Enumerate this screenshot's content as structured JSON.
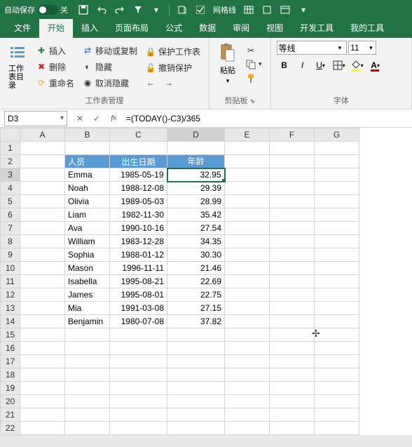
{
  "titlebar": {
    "autosave_label": "自动保存",
    "autosave_state": "关",
    "gridlines_label": "网格线"
  },
  "tabs": {
    "file": "文件",
    "home": "开始",
    "insert": "插入",
    "pagelayout": "页面布局",
    "formulas": "公式",
    "data": "数据",
    "review": "审阅",
    "view": "视图",
    "developer": "开发工具",
    "mytools": "我的工具"
  },
  "ribbon": {
    "toc_label": "工作表目录",
    "insert_label": "插入",
    "delete_label": "删除",
    "rename_label": "重命名",
    "movecopy_label": "移动或复制",
    "hide_label": "隐藏",
    "unhide_label": "取消隐藏",
    "protect_label": "保护工作表",
    "unprotect_label": "撤销保护",
    "group_sheetmgmt": "工作表管理",
    "paste_label": "粘贴",
    "group_clipboard": "剪贴板",
    "group_font": "字体"
  },
  "font": {
    "name": "等线",
    "size": "11"
  },
  "formula_bar": {
    "cell_ref": "D3",
    "formula": "=(TODAY()-C3)/365"
  },
  "columns": [
    "A",
    "B",
    "C",
    "D",
    "E",
    "F",
    "G"
  ],
  "sheet": {
    "header": {
      "person": "人员",
      "birthdate": "出生日期",
      "age": "年龄"
    },
    "rows": [
      {
        "person": "Emma",
        "birthdate": "1985-05-19",
        "age": "32.95"
      },
      {
        "person": "Noah",
        "birthdate": "1988-12-08",
        "age": "29.39"
      },
      {
        "person": "Olivia",
        "birthdate": "1989-05-03",
        "age": "28.99"
      },
      {
        "person": "Liam",
        "birthdate": "1982-11-30",
        "age": "35.42"
      },
      {
        "person": "Ava",
        "birthdate": "1990-10-16",
        "age": "27.54"
      },
      {
        "person": "William",
        "birthdate": "1983-12-28",
        "age": "34.35"
      },
      {
        "person": "Sophia",
        "birthdate": "1988-01-12",
        "age": "30.30"
      },
      {
        "person": "Mason",
        "birthdate": "1996-11-11",
        "age": "21.46"
      },
      {
        "person": "Isabella",
        "birthdate": "1995-08-21",
        "age": "22.69"
      },
      {
        "person": "James",
        "birthdate": "1995-08-01",
        "age": "22.75"
      },
      {
        "person": "Mia",
        "birthdate": "1991-03-08",
        "age": "27.15"
      },
      {
        "person": "Benjamin",
        "birthdate": "1980-07-08",
        "age": "37.82"
      }
    ]
  }
}
